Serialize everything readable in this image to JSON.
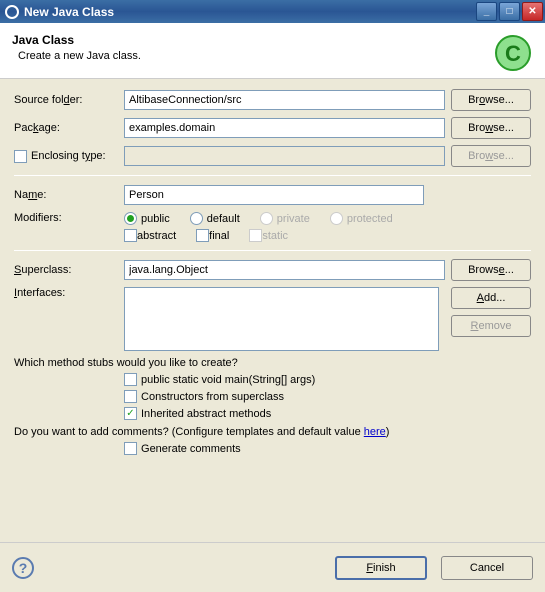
{
  "window": {
    "title": "New Java Class"
  },
  "header": {
    "title": "Java Class",
    "subtitle": "Create a new Java class."
  },
  "fields": {
    "source_folder": {
      "label": "Source folder:",
      "value": "AltibaseConnection/src",
      "browse": "Browse..."
    },
    "package": {
      "label": "Package:",
      "value": "examples.domain",
      "browse": "Browse..."
    },
    "enclosing_type": {
      "label": "Enclosing type:",
      "value": "",
      "browse": "Browse...",
      "checked": false
    },
    "name": {
      "label": "Name:",
      "value": "Person"
    },
    "modifiers": {
      "label": "Modifiers:",
      "access": {
        "public": "public",
        "default": "default",
        "private": "private",
        "protected": "protected",
        "selected": "public"
      },
      "abstract": {
        "label": "abstract",
        "checked": false
      },
      "final": {
        "label": "final",
        "checked": false
      },
      "static": {
        "label": "static",
        "checked": false
      }
    },
    "superclass": {
      "label": "Superclass:",
      "value": "java.lang.Object",
      "browse": "Browse..."
    },
    "interfaces": {
      "label": "Interfaces:",
      "add": "Add...",
      "remove": "Remove"
    }
  },
  "stubs": {
    "question": "Which method stubs would you like to create?",
    "main": {
      "label": "public static void main(String[] args)",
      "checked": false
    },
    "constructors": {
      "label": "Constructors from superclass",
      "checked": false
    },
    "inherited": {
      "label": "Inherited abstract methods",
      "checked": true
    }
  },
  "comments": {
    "question_pre": "Do you want to add comments? (Configure templates and default value ",
    "link": "here",
    "question_post": ")",
    "generate": {
      "label": "Generate comments",
      "checked": false
    }
  },
  "footer": {
    "finish": "Finish",
    "cancel": "Cancel"
  }
}
